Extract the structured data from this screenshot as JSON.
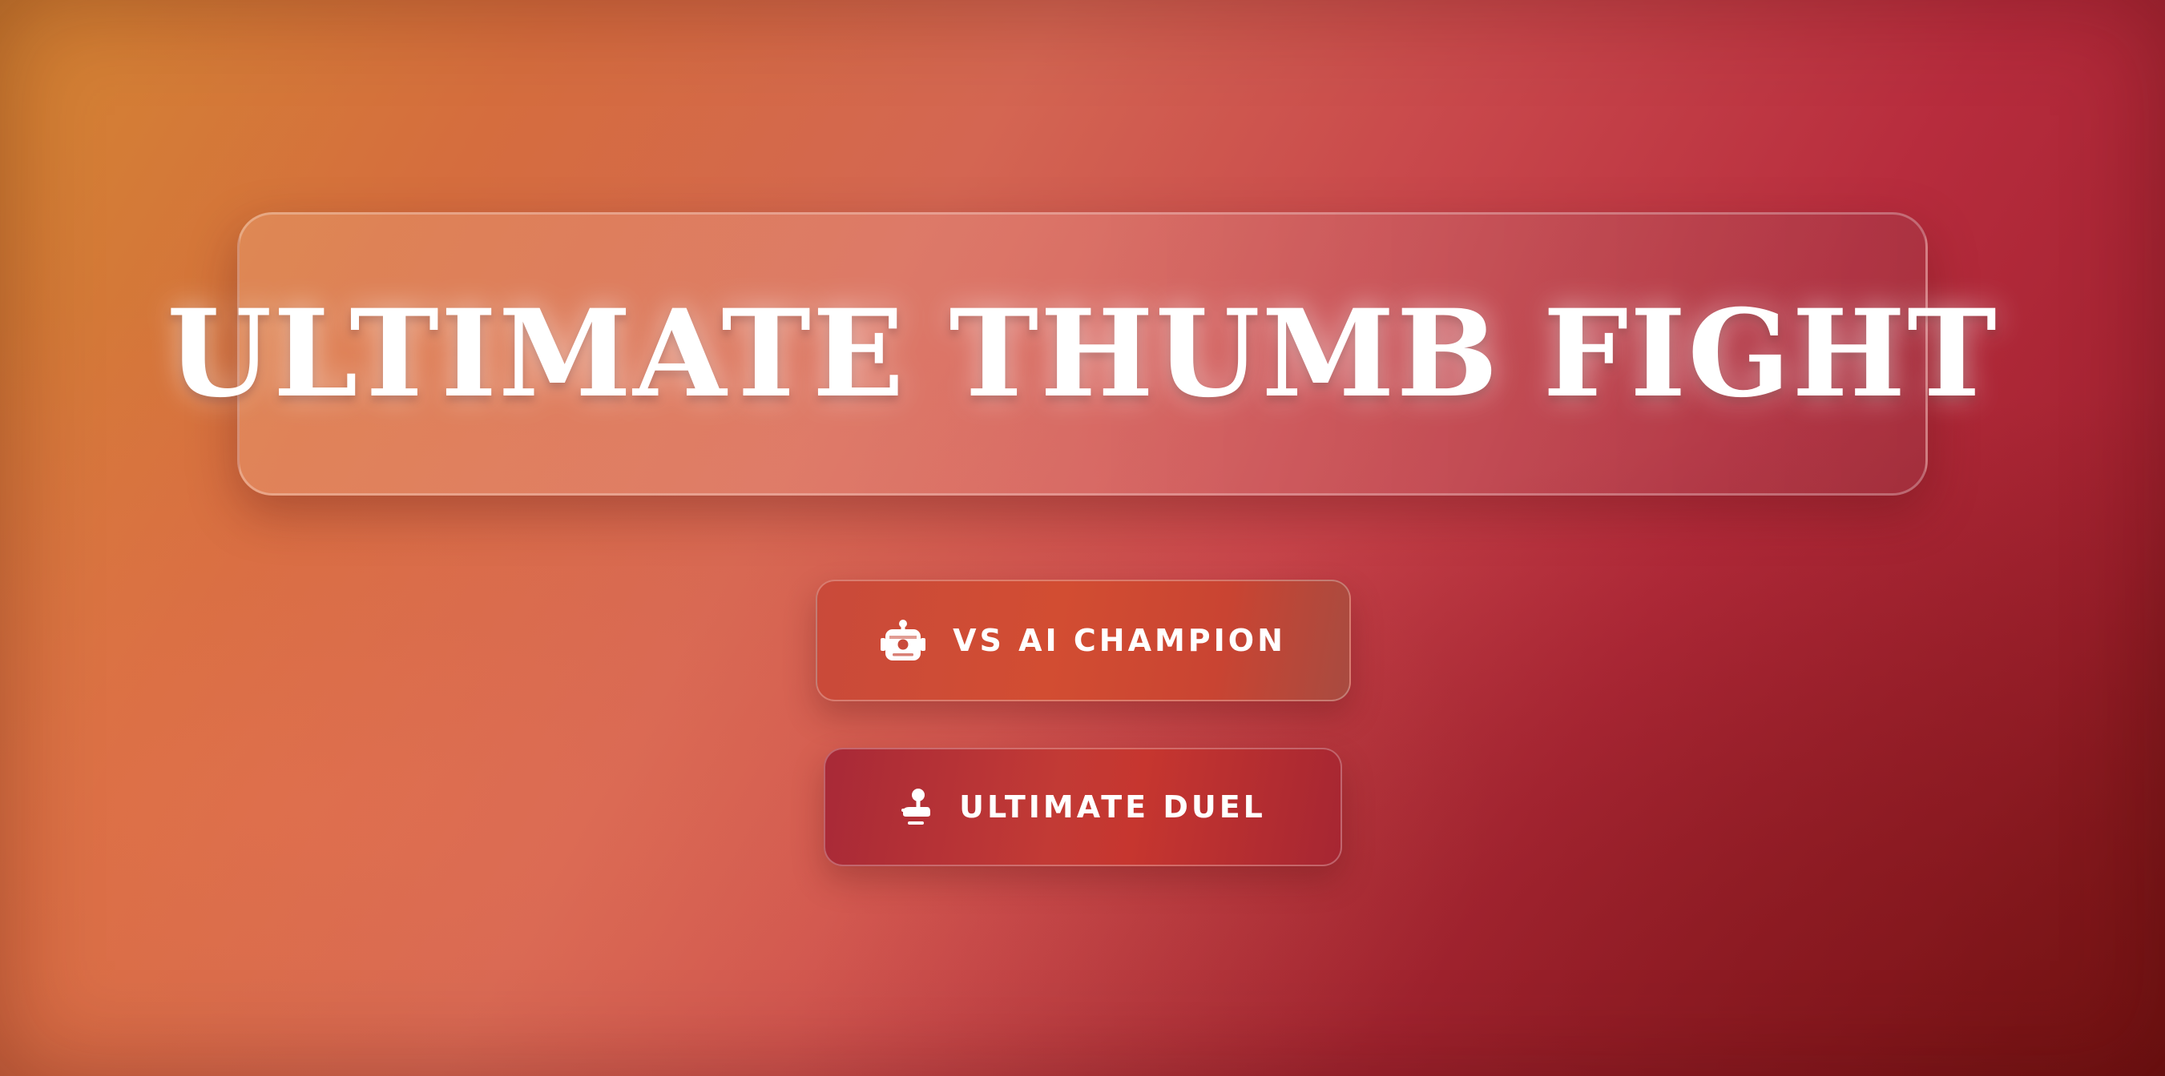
{
  "title": "ULTIMATE THUMB FIGHT",
  "menu": {
    "vs_ai": {
      "label": "VS AI CHAMPION",
      "icon": "robot-icon"
    },
    "duel": {
      "label": "ULTIMATE DUEL",
      "icon": "joystick-icon"
    }
  },
  "colors": {
    "background_start": "#d48532",
    "background_end": "#7e1a1a",
    "text": "#ffffff"
  }
}
